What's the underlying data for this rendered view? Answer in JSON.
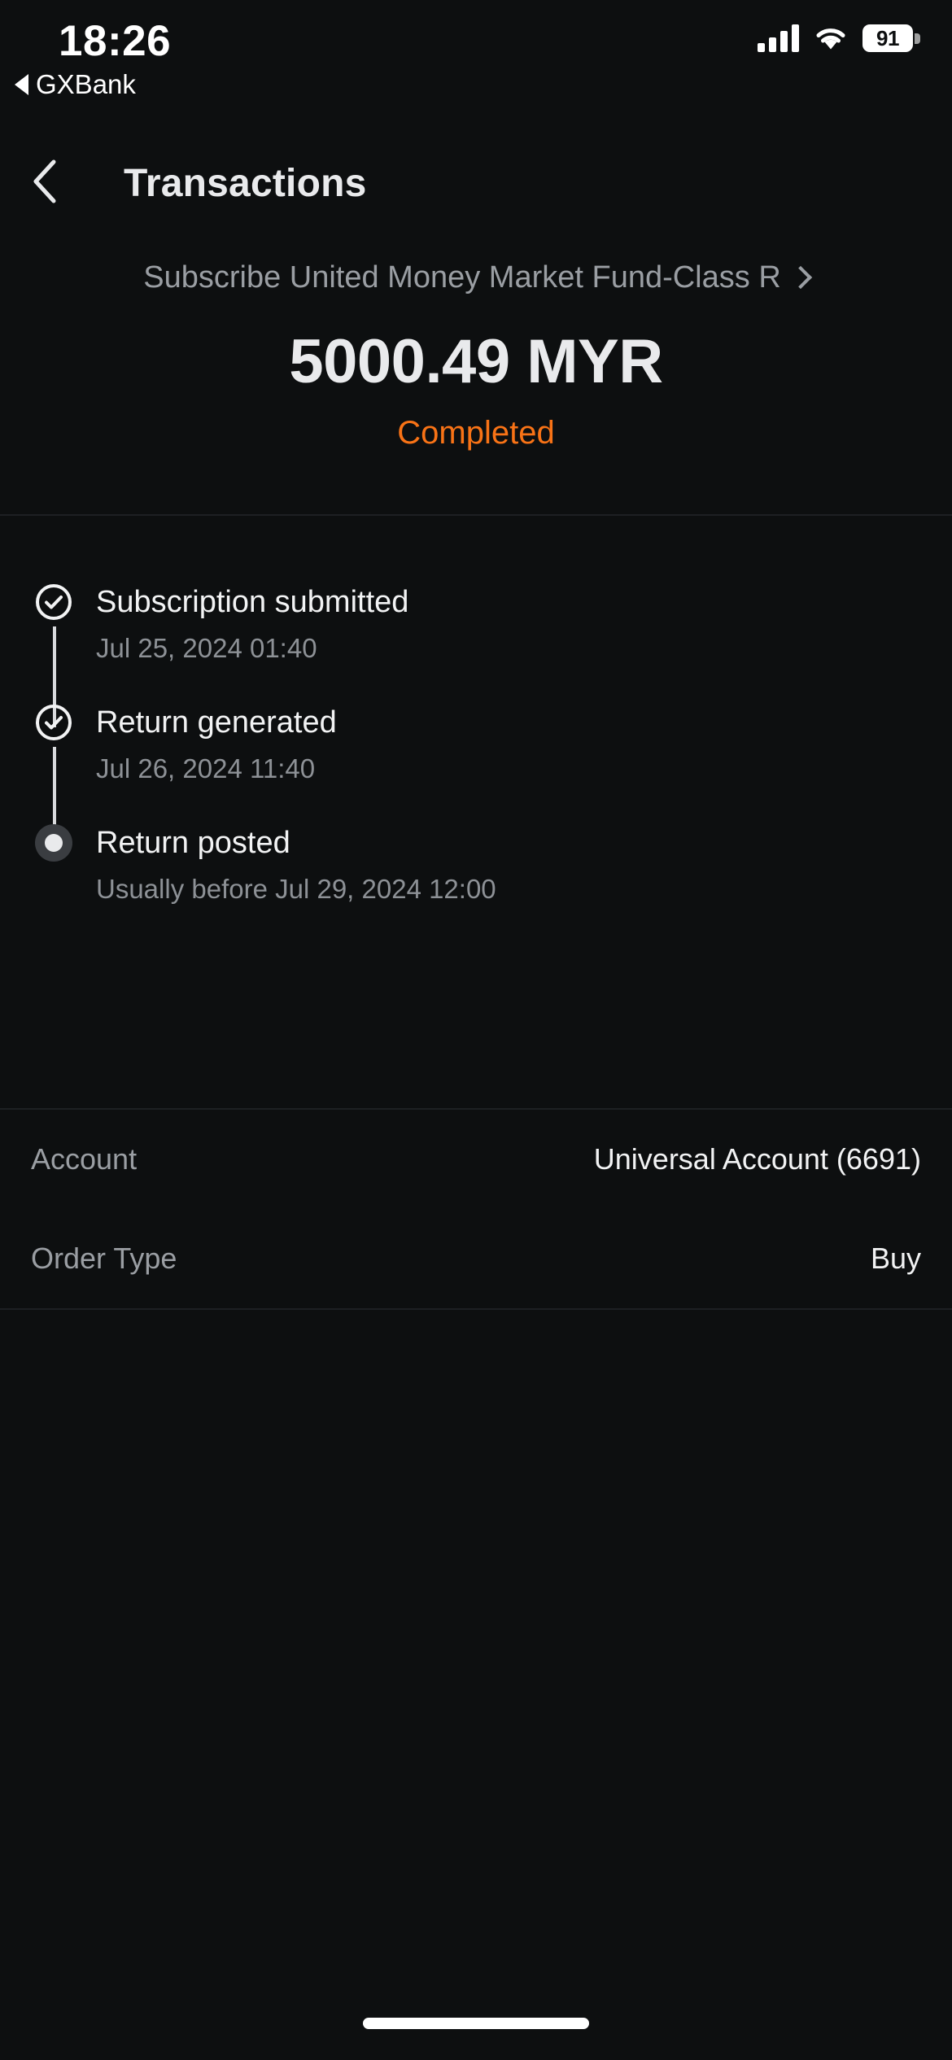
{
  "status_bar": {
    "time": "18:26",
    "return_to_app": "GXBank",
    "battery_percent": "91",
    "icons": {
      "return_arrow": "triangle-left-icon",
      "cellular": "signal-bars-icon",
      "wifi": "wifi-icon",
      "battery": "battery-icon"
    }
  },
  "nav": {
    "back_icon": "chevron-left-icon",
    "title": "Transactions"
  },
  "summary": {
    "fund_name": "Subscribe United Money Market Fund-Class R",
    "fund_chevron_icon": "chevron-right-icon",
    "amount": "5000.49 MYR",
    "status": "Completed",
    "status_color": "#f97316"
  },
  "timeline": {
    "steps": [
      {
        "title": "Subscription submitted",
        "subtitle": "Jul 25, 2024 01:40",
        "marker_icon": "check-circle-icon",
        "state": "done"
      },
      {
        "title": "Return generated",
        "subtitle": "Jul 26, 2024 11:40",
        "marker_icon": "check-circle-icon",
        "state": "done"
      },
      {
        "title": "Return posted",
        "subtitle": "Usually before Jul 29, 2024 12:00",
        "marker_icon": "filled-dot-icon",
        "state": "pending"
      }
    ]
  },
  "details": {
    "rows": [
      {
        "label": "Account",
        "value": "Universal Account (6691)"
      },
      {
        "label": "Order Type",
        "value": "Buy"
      }
    ]
  }
}
